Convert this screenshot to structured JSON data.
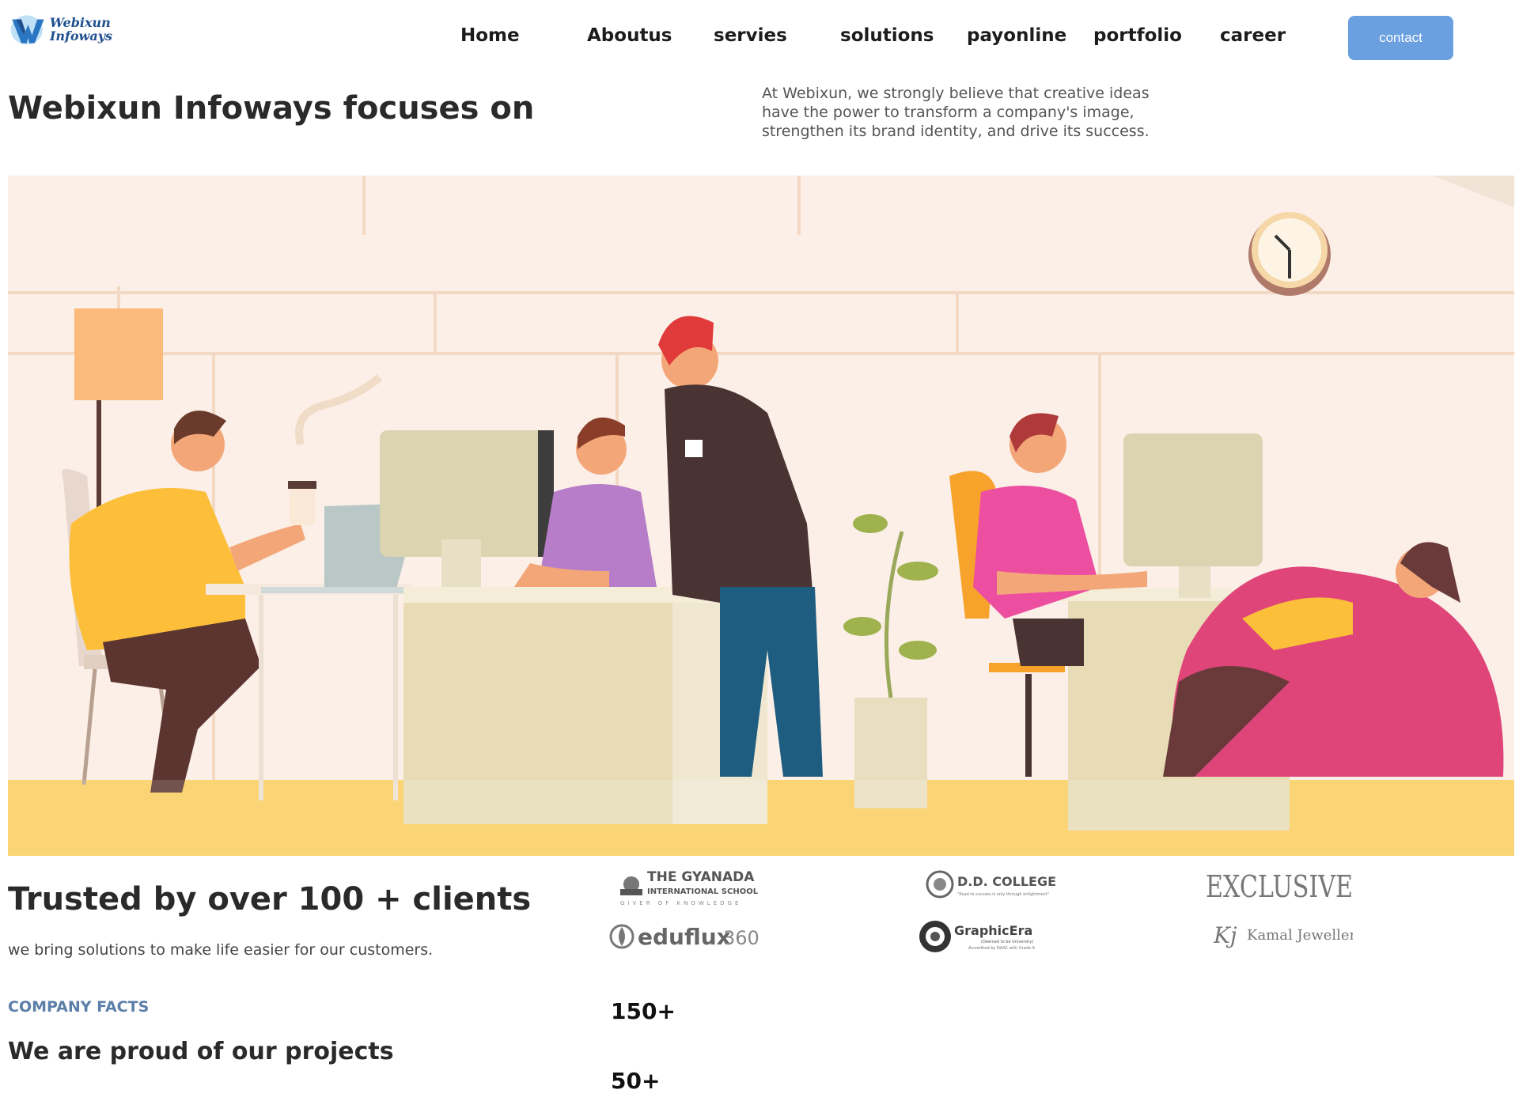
{
  "brand": {
    "line1": "Webixun",
    "line2": "Infoways"
  },
  "nav": {
    "items": [
      {
        "label": "Home"
      },
      {
        "label": "Aboutus"
      },
      {
        "label": "servies"
      },
      {
        "label": "solutions"
      },
      {
        "label": "payonline"
      },
      {
        "label": "portfolio"
      },
      {
        "label": "career"
      }
    ],
    "contact_label": "contact"
  },
  "hero": {
    "title": "Webixun Infoways focuses on",
    "description": "At Webixun, we strongly believe that creative ideas have the power to transform a company's image, strengthen its brand identity, and drive its success."
  },
  "trusted": {
    "title": "Trusted by over 100 + clients",
    "subtitle": "we bring solutions to make life easier for our customers."
  },
  "facts": {
    "label": "COMPANY FACTS",
    "title": "We are proud of our projects",
    "stats": [
      "150+",
      "50+"
    ]
  },
  "clients": {
    "gyanada": {
      "line1": "THE GYANADA",
      "line2": "INTERNATIONAL SCHOOL",
      "line3": "GIVER OF KNOWLEDGE"
    },
    "ddcollege": {
      "name": "D.D. COLLEGE",
      "tagline": "\"Road to success is only through enlightment\""
    },
    "exclusive": {
      "name": "EXCLUSIVE"
    },
    "eduflux": {
      "name": "eduflux",
      "suffix": "360"
    },
    "graphicera": {
      "name": "GraphicEra",
      "line2": "(Deemed to be University)",
      "line3": "Accredited by NAAC with Grade A"
    },
    "kamal": {
      "name": "Kamal Jewellers"
    }
  },
  "colors": {
    "accent": "#6a9fe0",
    "facts_label": "#5b7fa8",
    "illustration_bg": "#fbefe7",
    "floor": "#f8c34a"
  }
}
